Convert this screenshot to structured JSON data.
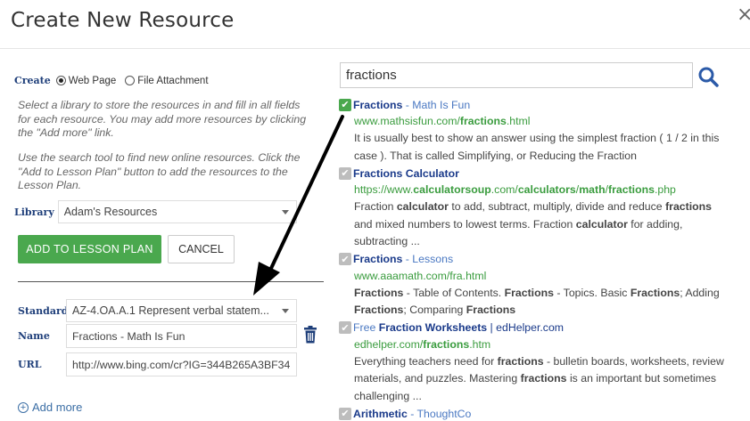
{
  "dialog": {
    "title": "Create New Resource",
    "close_glyph": "×"
  },
  "form": {
    "create_label": "Create",
    "option_web": "Web Page",
    "option_file": "File Attachment",
    "selected_option": "Web Page",
    "help1": "Select a library to store the resources in and fill in all fields for each resource. You may add more resources by clicking the \"Add more\" link.",
    "help2": "Use the search tool to find new online resources. Click the \"Add to Lesson Plan\" button to add the resources to the Lesson Plan.",
    "library_label": "Library",
    "library_value": "Adam's Resources",
    "add_button": "ADD TO LESSON PLAN",
    "cancel_button": "CANCEL",
    "standard_label": "Standard",
    "standard_value": "AZ-4.OA.A.1 Represent verbal statem...",
    "name_label": "Name",
    "name_value": "Fractions - Math Is Fun",
    "url_label": "URL",
    "url_value": "http://www.bing.com/cr?IG=344B265A3BF34",
    "add_more": "Add more"
  },
  "search": {
    "query": "fractions",
    "icon": "search-icon"
  },
  "results": [
    {
      "checked": true,
      "title_html": "<b>Fractions</b> <span class=\"muted\">- Math Is Fun</span>",
      "url_html": "www.mathsisfun.com/<b>fractions</b>.html",
      "desc_html": "It is usually best to show an answer using the simplest fraction ( 1 / 2 in this case ). That is called Simplifying, or Reducing the Fraction"
    },
    {
      "checked": false,
      "title_html": "<b>Fractions Calculator</b>",
      "url_html": "https://www.<b>calculatorsoup</b>.com/<b>calculators</b>/<b>math</b>/<b>fractions</b>.php",
      "desc_html": "Fraction <b>calculator</b> to add, subtract, multiply, divide and reduce <b>fractions</b> and mixed numbers to lowest terms. Fraction <b>calculator</b> for adding, subtracting ..."
    },
    {
      "checked": false,
      "title_html": "<b>Fractions</b> <span class=\"muted\">- Lessons</span>",
      "url_html": "www.aaamath.com/fra.html",
      "desc_html": "<b>Fractions</b> - Table of Contents. <b>Fractions</b> - Topics. Basic <b>Fractions</b>; Adding <b>Fractions</b>; Comparing <b>Fractions</b>"
    },
    {
      "checked": false,
      "title_html": "<span class=\"muted\">Free</span> <b>Fraction Worksheets</b> | edHelper.com",
      "url_html": "edhelper.com/<b>fractions</b>.htm",
      "desc_html": "Everything teachers need for <b>fractions</b> - bulletin boards, worksheets, review materials, and puzzles. Mastering <b>fractions</b> is an important but sometimes challenging ..."
    },
    {
      "checked": false,
      "title_html": "<b>Arithmetic</b> <span class=\"muted\">- ThoughtCo</span>",
      "url_html": "",
      "desc_html": ""
    }
  ]
}
